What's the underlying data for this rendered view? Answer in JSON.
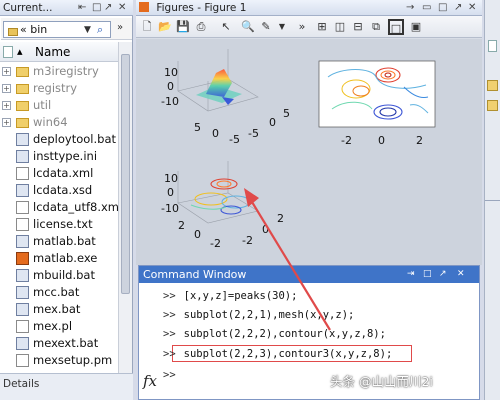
{
  "current_folder": {
    "title": "Current...",
    "path": "« bin",
    "column_header": "Name",
    "files": [
      {
        "name": "m3iregistry",
        "type": "folder",
        "expandable": true
      },
      {
        "name": "registry",
        "type": "folder",
        "expandable": true
      },
      {
        "name": "util",
        "type": "folder",
        "expandable": true
      },
      {
        "name": "win64",
        "type": "folder",
        "expandable": true
      },
      {
        "name": "deploytool.bat",
        "type": "gear"
      },
      {
        "name": "insttype.ini",
        "type": "gear"
      },
      {
        "name": "lcdata.xml",
        "type": "doc"
      },
      {
        "name": "lcdata.xsd",
        "type": "gear"
      },
      {
        "name": "lcdata_utf8.xml",
        "type": "doc"
      },
      {
        "name": "license.txt",
        "type": "doc"
      },
      {
        "name": "matlab.bat",
        "type": "gear"
      },
      {
        "name": "matlab.exe",
        "type": "mat"
      },
      {
        "name": "mbuild.bat",
        "type": "gear"
      },
      {
        "name": "mcc.bat",
        "type": "gear"
      },
      {
        "name": "mex.bat",
        "type": "gear"
      },
      {
        "name": "mex.pl",
        "type": "doc"
      },
      {
        "name": "mexext.bat",
        "type": "gear"
      },
      {
        "name": "mexsetup.pm",
        "type": "doc"
      }
    ],
    "details_label": "Details"
  },
  "figure_window": {
    "title": "Figures - Figure 1",
    "subplot_ticks": {
      "mesh_z": [
        "10",
        "0",
        "-10"
      ],
      "mesh_x": [
        "5",
        "0",
        "-5"
      ],
      "mesh_y": [
        "-5",
        "0",
        "5"
      ],
      "contour_x": [
        "-2",
        "0",
        "2"
      ],
      "contour3_z": [
        "10",
        "0",
        "-10"
      ],
      "contour3_x": [
        "2",
        "0",
        "-2"
      ],
      "contour3_y": [
        "-2",
        "0",
        "2"
      ]
    }
  },
  "command_window": {
    "title": "Command Window",
    "prompt": ">>",
    "fx_label": "fx",
    "lines": [
      "[x,y,z]=peaks(30);",
      "subplot(2,2,1),mesh(x,y,z);",
      "subplot(2,2,2),contour(x,y,z,8);",
      "subplot(2,2,3),contour3(x,y,z,8);",
      ""
    ]
  },
  "watermark": "头条 @山山而川2i",
  "colors": {
    "cmd_title_bg": "#3f74c8",
    "annotation_red": "#e04a4a"
  }
}
